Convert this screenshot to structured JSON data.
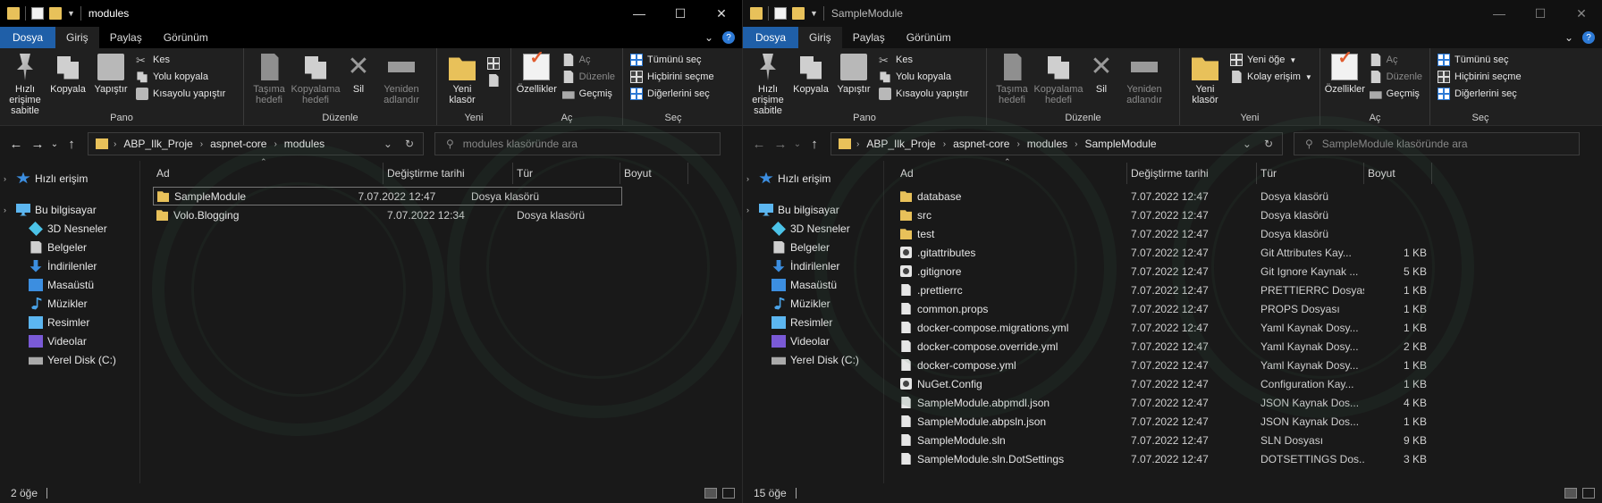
{
  "left": {
    "title": "modules",
    "tabs": [
      "Dosya",
      "Giriş",
      "Paylaş",
      "Görünüm"
    ],
    "ribbon": {
      "pano": {
        "label": "Pano",
        "pin": "Hızlı erişime sabitle",
        "copy": "Kopyala",
        "paste": "Yapıştır",
        "cut": "Kes",
        "copy_path": "Yolu kopyala",
        "paste_shortcut": "Kısayolu yapıştır"
      },
      "duzenle": {
        "label": "Düzenle",
        "move": "Taşıma hedefi",
        "copyto": "Kopyalama hedefi",
        "delete": "Sil",
        "rename": "Yeniden adlandır"
      },
      "yeni": {
        "label": "Yeni",
        "new_folder": "Yeni klasör",
        "new_item": "",
        "easy_access": ""
      },
      "ac": {
        "label": "Aç",
        "properties": "Özellikler",
        "open": "Aç",
        "edit": "Düzenle",
        "history": "Geçmiş"
      },
      "sec": {
        "label": "Seç",
        "select_all": "Tümünü seç",
        "select_none": "Hiçbirini seçme",
        "invert": "Diğerlerini seç"
      }
    },
    "breadcrumb": [
      "ABP_Ilk_Proje",
      "aspnet-core",
      "modules"
    ],
    "search_placeholder": "modules klasöründe ara",
    "columns": {
      "name": "Ad",
      "date": "Değiştirme tarihi",
      "type": "Tür",
      "size": "Boyut"
    },
    "files": [
      {
        "name": "SampleModule",
        "date": "7.07.2022 12:47",
        "type": "Dosya klasörü",
        "size": "",
        "icon": "folder"
      },
      {
        "name": "Volo.Blogging",
        "date": "7.07.2022 12:34",
        "type": "Dosya klasörü",
        "size": "",
        "icon": "folder"
      }
    ],
    "status": "2 öğe"
  },
  "right": {
    "title": "SampleModule",
    "tabs": [
      "Dosya",
      "Giriş",
      "Paylaş",
      "Görünüm"
    ],
    "ribbon": {
      "pano": {
        "label": "Pano",
        "pin": "Hızlı erişime sabitle",
        "copy": "Kopyala",
        "paste": "Yapıştır",
        "cut": "Kes",
        "copy_path": "Yolu kopyala",
        "paste_shortcut": "Kısayolu yapıştır"
      },
      "duzenle": {
        "label": "Düzenle",
        "move": "Taşıma hedefi",
        "copyto": "Kopyalama hedefi",
        "delete": "Sil",
        "rename": "Yeniden adlandır"
      },
      "yeni": {
        "label": "Yeni",
        "new_folder": "Yeni klasör",
        "new_item": "Yeni öğe",
        "easy_access": "Kolay erişim"
      },
      "ac": {
        "label": "Aç",
        "properties": "Özellikler",
        "open": "Aç",
        "edit": "Düzenle",
        "history": "Geçmiş"
      },
      "sec": {
        "label": "Seç",
        "select_all": "Tümünü seç",
        "select_none": "Hiçbirini seçme",
        "invert": "Diğerlerini seç"
      }
    },
    "breadcrumb": [
      "ABP_Ilk_Proje",
      "aspnet-core",
      "modules",
      "SampleModule"
    ],
    "search_placeholder": "SampleModule klasöründe ara",
    "columns": {
      "name": "Ad",
      "date": "Değiştirme tarihi",
      "type": "Tür",
      "size": "Boyut"
    },
    "files": [
      {
        "name": "database",
        "date": "7.07.2022 12:47",
        "type": "Dosya klasörü",
        "size": "",
        "icon": "folder"
      },
      {
        "name": "src",
        "date": "7.07.2022 12:47",
        "type": "Dosya klasörü",
        "size": "",
        "icon": "folder"
      },
      {
        "name": "test",
        "date": "7.07.2022 12:47",
        "type": "Dosya klasörü",
        "size": "",
        "icon": "folder"
      },
      {
        "name": ".gitattributes",
        "date": "7.07.2022 12:47",
        "type": "Git Attributes Kay...",
        "size": "1 KB",
        "icon": "gear"
      },
      {
        "name": ".gitignore",
        "date": "7.07.2022 12:47",
        "type": "Git Ignore Kaynak ...",
        "size": "5 KB",
        "icon": "gear"
      },
      {
        "name": ".prettierrc",
        "date": "7.07.2022 12:47",
        "type": "PRETTIERRC Dosyası",
        "size": "1 KB",
        "icon": "file"
      },
      {
        "name": "common.props",
        "date": "7.07.2022 12:47",
        "type": "PROPS Dosyası",
        "size": "1 KB",
        "icon": "file"
      },
      {
        "name": "docker-compose.migrations.yml",
        "date": "7.07.2022 12:47",
        "type": "Yaml Kaynak Dosy...",
        "size": "1 KB",
        "icon": "file"
      },
      {
        "name": "docker-compose.override.yml",
        "date": "7.07.2022 12:47",
        "type": "Yaml Kaynak Dosy...",
        "size": "2 KB",
        "icon": "file"
      },
      {
        "name": "docker-compose.yml",
        "date": "7.07.2022 12:47",
        "type": "Yaml Kaynak Dosy...",
        "size": "1 KB",
        "icon": "file"
      },
      {
        "name": "NuGet.Config",
        "date": "7.07.2022 12:47",
        "type": "Configuration Kay...",
        "size": "1 KB",
        "icon": "gear"
      },
      {
        "name": "SampleModule.abpmdl.json",
        "date": "7.07.2022 12:47",
        "type": "JSON Kaynak Dos...",
        "size": "4 KB",
        "icon": "file"
      },
      {
        "name": "SampleModule.abpsln.json",
        "date": "7.07.2022 12:47",
        "type": "JSON Kaynak Dos...",
        "size": "1 KB",
        "icon": "file"
      },
      {
        "name": "SampleModule.sln",
        "date": "7.07.2022 12:47",
        "type": "SLN Dosyası",
        "size": "9 KB",
        "icon": "file"
      },
      {
        "name": "SampleModule.sln.DotSettings",
        "date": "7.07.2022 12:47",
        "type": "DOTSETTINGS Dos...",
        "size": "3 KB",
        "icon": "file"
      }
    ],
    "status": "15 öğe"
  },
  "nav": [
    {
      "label": "Hızlı erişim",
      "icon": "star-icon"
    },
    {
      "label": "Bu bilgisayar",
      "icon": "computer-icon"
    },
    {
      "label": "3D Nesneler",
      "icon": "cube-icon"
    },
    {
      "label": "Belgeler",
      "icon": "documents-icon"
    },
    {
      "label": "İndirilenler",
      "icon": "download-icon"
    },
    {
      "label": "Masaüstü",
      "icon": "desktop-icon"
    },
    {
      "label": "Müzikler",
      "icon": "music-icon"
    },
    {
      "label": "Resimler",
      "icon": "pictures-icon"
    },
    {
      "label": "Videolar",
      "icon": "videos-icon"
    },
    {
      "label": "Yerel Disk (C:)",
      "icon": "disk-icon"
    }
  ]
}
